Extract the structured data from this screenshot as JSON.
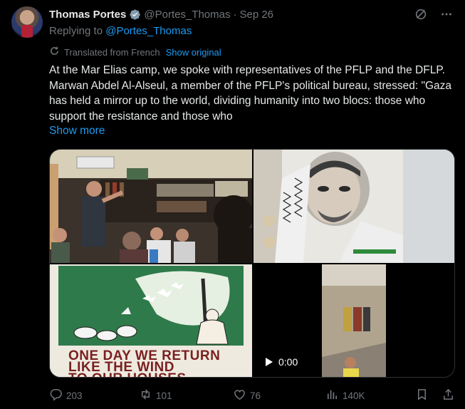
{
  "author": {
    "name": "Thomas Portes",
    "handle": "@Portes_Thomas",
    "separator": "·",
    "date": "Sep 26"
  },
  "reply": {
    "prefix": "Replying to",
    "mention": "@Portes_Thomas"
  },
  "translation": {
    "label": "Translated from French",
    "show_original": "Show original"
  },
  "post": {
    "text": "At the Mar Elias camp, we spoke with representatives of the PFLP and the DFLP. Marwan Abdel Al-Alseul, a member of the PFLP's political bureau, stressed: \"Gaza has held a mirror up to the world, dividing humanity into two blocs: those who support the resistance and those who",
    "show_more": "Show more"
  },
  "media": {
    "poster_lines": [
      "ONE DAY WE RETURN",
      "LIKE THE WIND",
      "TO OUR HOUSES"
    ],
    "video_time": "0:00"
  },
  "actions": {
    "replies": "203",
    "reposts": "101",
    "likes": "76",
    "views": "140K"
  },
  "icons": {
    "verified": "verified-badge-icon",
    "grok": "grok-icon",
    "more": "more-icon",
    "translate": "translate-icon"
  },
  "colors": {
    "background": "#000000",
    "text": "#e7e9ea",
    "muted": "#71767b",
    "accent": "#1d9bf0",
    "border": "#2f3336"
  }
}
